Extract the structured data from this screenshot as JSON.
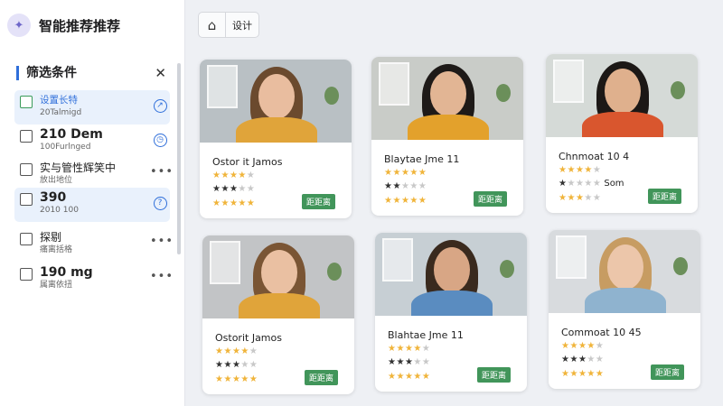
{
  "app": {
    "title": "智能推荐推荐",
    "logo_icon": "sparkle-icon"
  },
  "toolbar": {
    "home_icon": "home-icon",
    "settings_label": "设计"
  },
  "filters": {
    "title": "筛选条件",
    "items": [
      {
        "line1": "设置长特",
        "line2": "20Talmigd",
        "right_icon": "arrow-circle-icon",
        "highlight": true
      },
      {
        "line1": "210 Dem",
        "line2": "100Furlnged",
        "right_icon": "clock-circle-icon",
        "highlight": false
      },
      {
        "line1": "实与管性辉笑中",
        "line2": "放出地位",
        "right_icon": "more-icon",
        "highlight": false
      },
      {
        "line1": "390",
        "line2": "2010 100",
        "right_icon": "info-circle-icon",
        "highlight": true
      },
      {
        "line1": "探剔",
        "line2": "痛离括格",
        "right_icon": "more-icon",
        "highlight": false
      },
      {
        "line1": "190 mg",
        "line2": "属离依扭",
        "right_icon": "more-icon",
        "highlight": false
      }
    ]
  },
  "cards": [
    {
      "name": "Ostor it Jamos",
      "r1": 4,
      "r2": 3,
      "r3": 5,
      "r2_label": "",
      "tag": "距距离"
    },
    {
      "name": "Blaytae Jme 11",
      "r1": 5,
      "r2": 2,
      "r3": 5,
      "r2_label": "",
      "tag": "距距离"
    },
    {
      "name": "Chnmoat 10 4",
      "r1": 4,
      "r2": 1,
      "r3": 3,
      "r2_label": "Som",
      "tag": "距距离"
    },
    {
      "name": "Ostorit Jamos",
      "r1": 4,
      "r2": 3,
      "r3": 5,
      "r2_label": "",
      "tag": "距距离"
    },
    {
      "name": "Blahtae Jme 11",
      "r1": 4,
      "r2": 3,
      "r3": 5,
      "r2_label": "",
      "tag": "距距离"
    },
    {
      "name": "Commoat 10 45",
      "r1": 4,
      "r2": 3,
      "r3": 5,
      "r2_label": "",
      "tag": "距距离"
    }
  ],
  "colors": {
    "accent": "#2f6fda",
    "tag_green": "#41955a",
    "star_gold": "#f0b43a"
  }
}
